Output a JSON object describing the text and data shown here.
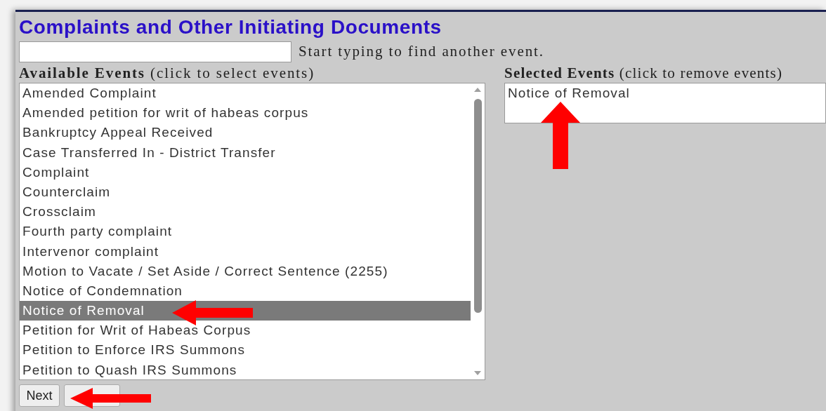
{
  "title": "Complaints and Other Initiating Documents",
  "search": {
    "hint": "Start typing to find another event."
  },
  "available": {
    "label": "**Available Events** (click to select events)",
    "items": [
      {
        "label": "Amended Complaint",
        "selected": false
      },
      {
        "label": "Amended petition for writ of habeas corpus",
        "selected": false
      },
      {
        "label": "Bankruptcy Appeal Received",
        "selected": false
      },
      {
        "label": "Case Transferred In - District Transfer",
        "selected": false
      },
      {
        "label": "Complaint",
        "selected": false
      },
      {
        "label": "Counterclaim",
        "selected": false
      },
      {
        "label": "Crossclaim",
        "selected": false
      },
      {
        "label": "Fourth party complaint",
        "selected": false
      },
      {
        "label": "Intervenor complaint",
        "selected": false
      },
      {
        "label": "Motion to Vacate / Set Aside / Correct Sentence (2255)",
        "selected": false
      },
      {
        "label": "Notice of Condemnation",
        "selected": false
      },
      {
        "label": "Notice of Removal",
        "selected": true
      },
      {
        "label": "Petition for Writ of Habeas Corpus",
        "selected": false
      },
      {
        "label": "Petition to Enforce IRS Summons",
        "selected": false
      },
      {
        "label": "Petition to Quash IRS Summons",
        "selected": false
      }
    ]
  },
  "selected_events": {
    "label": "**Selected Events** (click to remove events)",
    "items": [
      "Notice of Removal"
    ]
  },
  "buttons": [
    "Next"
  ]
}
